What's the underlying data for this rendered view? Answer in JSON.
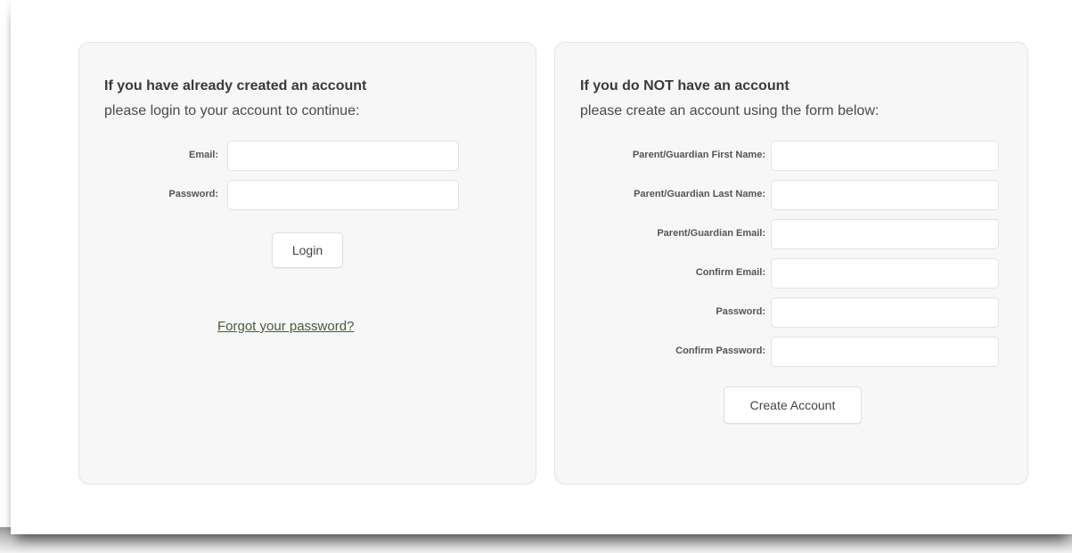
{
  "login": {
    "heading": "If you have already created an account",
    "subheading": "please login to your account to continue:",
    "fields": [
      {
        "label": "Email:",
        "value": "",
        "placeholder": ""
      },
      {
        "label": "Password:",
        "value": "",
        "placeholder": ""
      }
    ],
    "login_button": "Login",
    "forgot_link": "Forgot your password?"
  },
  "register": {
    "heading": "If you do NOT have an account",
    "subheading": "please create an account using the form below:",
    "fields": [
      {
        "label": "Parent/Guardian First Name:",
        "value": "",
        "placeholder": ""
      },
      {
        "label": "Parent/Guardian Last Name:",
        "value": "",
        "placeholder": ""
      },
      {
        "label": "Parent/Guardian Email:",
        "value": "",
        "placeholder": ""
      },
      {
        "label": "Confirm Email:",
        "value": "",
        "placeholder": ""
      },
      {
        "label": "Password:",
        "value": "",
        "placeholder": ""
      },
      {
        "label": "Confirm Password:",
        "value": "",
        "placeholder": ""
      }
    ],
    "create_button": "Create Account"
  }
}
